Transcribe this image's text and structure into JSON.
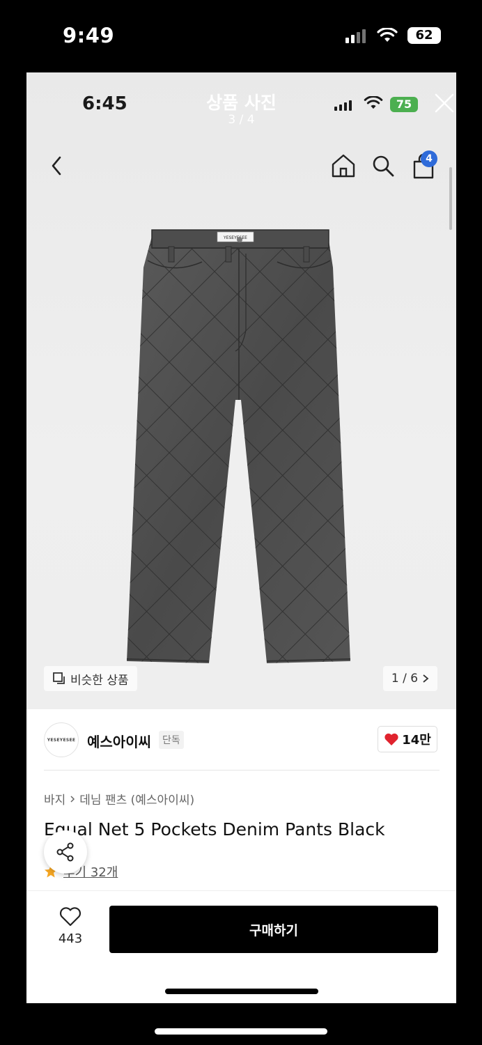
{
  "outer_status": {
    "time": "9:49",
    "battery": "62"
  },
  "viewer": {
    "inner_time": "6:45",
    "title": "상품 사진",
    "counter": "3 / 4",
    "inner_battery": "75"
  },
  "nav": {
    "cart_count": "4"
  },
  "image": {
    "similar_label": "비슷한 상품",
    "pager": "1 / 6",
    "tag_text": "YESEYESEE"
  },
  "brand": {
    "logo_text": "YESEYESEE",
    "name": "예스아이씨",
    "tag": "단독",
    "likes": "14만"
  },
  "product": {
    "breadcrumb": [
      "바지",
      "데님 팬츠 (예스아이씨)"
    ],
    "title": "Equal Net 5 Pockets Denim Pants Black",
    "reviews": "후기 32개"
  },
  "bottom": {
    "wish_count": "443",
    "buy_label": "구매하기"
  },
  "colors": {
    "accent_blue": "#2f6bd9",
    "heart_red": "#e0232e",
    "battery_green": "#4caf50",
    "star": "#f5a623"
  }
}
